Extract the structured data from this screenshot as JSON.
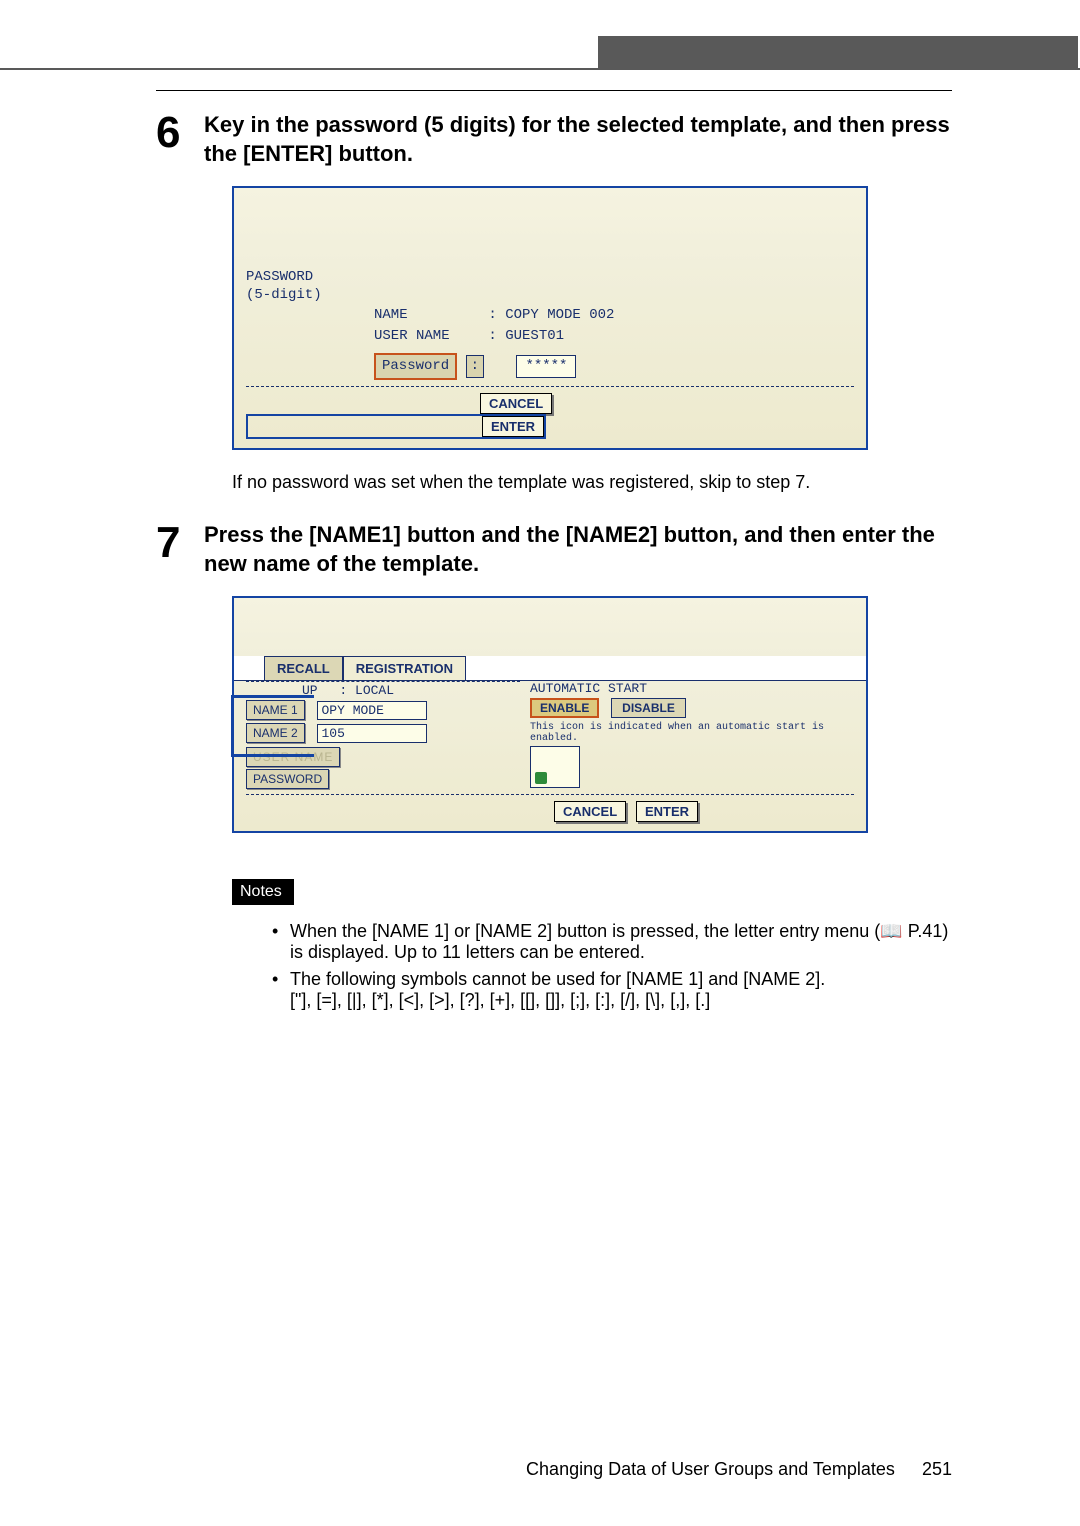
{
  "steps": {
    "s6": {
      "num": "6",
      "title": "Key in the password (5 digits) for the selected template, and then press the [ENTER] button."
    },
    "s7": {
      "num": "7",
      "title": "Press the [NAME1] button and the [NAME2] button, and then enter the new name of the template."
    }
  },
  "fig1": {
    "pw_label": "PASSWORD",
    "pw_sub": "(5-digit)",
    "name_label": "NAME",
    "name_value": ": COPY MODE 002",
    "user_label": "USER NAME",
    "user_value": ": GUEST01",
    "password_btn": "Password",
    "colon": ":",
    "mask": "*****",
    "cancel": "CANCEL",
    "enter": "ENTER"
  },
  "after_fig1": "If no password was set when the template was registered, skip to step 7.",
  "fig2": {
    "tab_recall": "RECALL",
    "tab_reg": "REGISTRATION",
    "group_label": ": LOCAL",
    "up_frag": "UP",
    "name1_btn": "NAME 1",
    "name1_val": "OPY MODE",
    "name2_btn": "NAME 2",
    "name2_val": "105",
    "username_btn": "USER NAME",
    "password_btn": "PASSWORD",
    "auto_label": "AUTOMATIC START",
    "enable": "ENABLE",
    "disable": "DISABLE",
    "icon_note": "This icon is indicated when an automatic start is enabled.",
    "cancel": "CANCEL",
    "enter": "ENTER"
  },
  "notes_label": "Notes",
  "bullets": {
    "b1a": "When the [NAME 1] or [NAME 2] button is pressed, the letter entry menu (",
    "b1_icon": "📖",
    "b1b": " P.41) is displayed. Up to 11 letters can be entered.",
    "b2a": "The following symbols cannot be used for [NAME 1] and [NAME 2].",
    "b2b": "[\"], [=], [|], [*], [<], [>], [?], [+], [[], []], [;], [:], [/], [\\], [,], [.]"
  },
  "footer": {
    "text": "Changing Data of User Groups and Templates",
    "page": "251"
  }
}
